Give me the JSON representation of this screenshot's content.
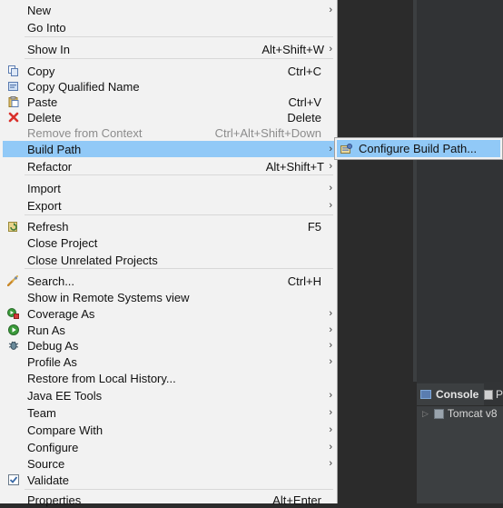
{
  "menu": {
    "items": [
      {
        "label": "New",
        "shortcut": "",
        "submenu": true,
        "icon": "",
        "disabled": false,
        "highlight": false
      },
      {
        "label": "Go Into",
        "shortcut": "",
        "submenu": false,
        "icon": "",
        "disabled": false,
        "highlight": false
      },
      {
        "label": "Show In",
        "shortcut": "Alt+Shift+W",
        "submenu": true,
        "icon": "",
        "disabled": false,
        "highlight": false
      },
      {
        "label": "Copy",
        "shortcut": "Ctrl+C",
        "submenu": false,
        "icon": "copy-icon",
        "disabled": false,
        "highlight": false
      },
      {
        "label": "Copy Qualified Name",
        "shortcut": "",
        "submenu": false,
        "icon": "copy-qualified-name-icon",
        "disabled": false,
        "highlight": false
      },
      {
        "label": "Paste",
        "shortcut": "Ctrl+V",
        "submenu": false,
        "icon": "paste-icon",
        "disabled": false,
        "highlight": false
      },
      {
        "label": "Delete",
        "shortcut": "Delete",
        "submenu": false,
        "icon": "delete-icon",
        "disabled": false,
        "highlight": false
      },
      {
        "label": "Remove from Context",
        "shortcut": "Ctrl+Alt+Shift+Down",
        "submenu": false,
        "icon": "remove-from-context-icon",
        "disabled": true,
        "highlight": false
      },
      {
        "label": "Build Path",
        "shortcut": "",
        "submenu": true,
        "icon": "",
        "disabled": false,
        "highlight": true
      },
      {
        "label": "Refactor",
        "shortcut": "Alt+Shift+T",
        "submenu": true,
        "icon": "",
        "disabled": false,
        "highlight": false
      },
      {
        "label": "Import",
        "shortcut": "",
        "submenu": true,
        "icon": "",
        "disabled": false,
        "highlight": false
      },
      {
        "label": "Export",
        "shortcut": "",
        "submenu": true,
        "icon": "",
        "disabled": false,
        "highlight": false
      },
      {
        "label": "Refresh",
        "shortcut": "F5",
        "submenu": false,
        "icon": "refresh-icon",
        "disabled": false,
        "highlight": false
      },
      {
        "label": "Close Project",
        "shortcut": "",
        "submenu": false,
        "icon": "",
        "disabled": false,
        "highlight": false
      },
      {
        "label": "Close Unrelated Projects",
        "shortcut": "",
        "submenu": false,
        "icon": "",
        "disabled": false,
        "highlight": false
      },
      {
        "label": "Search...",
        "shortcut": "Ctrl+H",
        "submenu": false,
        "icon": "search-icon",
        "disabled": false,
        "highlight": false
      },
      {
        "label": "Show in Remote Systems view",
        "shortcut": "",
        "submenu": false,
        "icon": "",
        "disabled": false,
        "highlight": false
      },
      {
        "label": "Coverage As",
        "shortcut": "",
        "submenu": true,
        "icon": "coverage-icon",
        "disabled": false,
        "highlight": false
      },
      {
        "label": "Run As",
        "shortcut": "",
        "submenu": true,
        "icon": "run-icon",
        "disabled": false,
        "highlight": false
      },
      {
        "label": "Debug As",
        "shortcut": "",
        "submenu": true,
        "icon": "debug-icon",
        "disabled": false,
        "highlight": false
      },
      {
        "label": "Profile As",
        "shortcut": "",
        "submenu": true,
        "icon": "",
        "disabled": false,
        "highlight": false
      },
      {
        "label": "Restore from Local History...",
        "shortcut": "",
        "submenu": false,
        "icon": "",
        "disabled": false,
        "highlight": false
      },
      {
        "label": "Java EE Tools",
        "shortcut": "",
        "submenu": true,
        "icon": "",
        "disabled": false,
        "highlight": false
      },
      {
        "label": "Team",
        "shortcut": "",
        "submenu": true,
        "icon": "",
        "disabled": false,
        "highlight": false
      },
      {
        "label": "Compare With",
        "shortcut": "",
        "submenu": true,
        "icon": "",
        "disabled": false,
        "highlight": false
      },
      {
        "label": "Configure",
        "shortcut": "",
        "submenu": true,
        "icon": "",
        "disabled": false,
        "highlight": false
      },
      {
        "label": "Source",
        "shortcut": "",
        "submenu": true,
        "icon": "",
        "disabled": false,
        "highlight": false
      },
      {
        "label": "Validate",
        "shortcut": "",
        "submenu": false,
        "icon": "validate-checkbox-icon",
        "disabled": false,
        "highlight": false
      },
      {
        "label": "Properties",
        "shortcut": "Alt+Enter",
        "submenu": false,
        "icon": "",
        "disabled": false,
        "highlight": false
      }
    ],
    "arrow_glyph": "›"
  },
  "submenu": {
    "label": "Configure Build Path...",
    "icon": "configure-build-path-icon"
  },
  "console": {
    "tab_label": "Console",
    "problems_tab_label": "P",
    "server_label": "Tomcat v8"
  },
  "colors": {
    "menu_bg": "#f2f2f2",
    "highlight": "#91c9f7",
    "editor_bg": "#2b2b2b",
    "disabled_text": "#8c8c8c",
    "delete_red": "#d9302b",
    "run_green": "#3a9b3a"
  }
}
